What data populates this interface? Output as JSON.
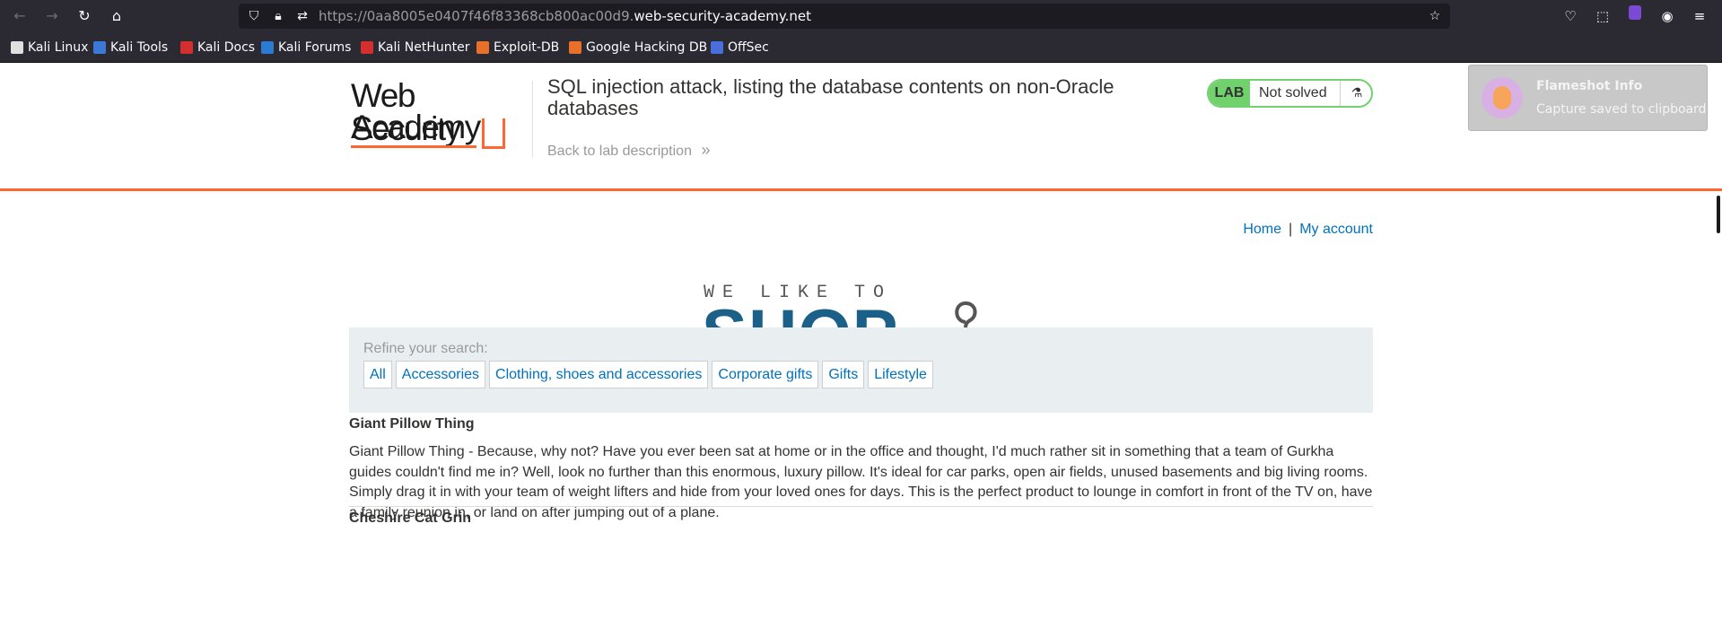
{
  "browser": {
    "url_prefix": "https://0aa8005e0407f46f83368cb800ac00d9.",
    "url_host": "web-security-academy.net",
    "icons": {
      "back": "back-arrow-icon",
      "forward": "forward-arrow-icon",
      "reload": "reload-icon",
      "home": "home-icon",
      "shield": "tracking-shield-icon",
      "lock": "lock-icon",
      "permissions": "permissions-icon",
      "bookmark_star": "star-icon",
      "pocket": "pocket-icon",
      "extensions": "extensions-icon",
      "menu": "hamburger-menu-icon"
    },
    "extension_badge": "1",
    "bookmarks": [
      {
        "label": "Kali Linux",
        "color": "#e0e0e0"
      },
      {
        "label": "Kali Tools",
        "color": "#3b78d8"
      },
      {
        "label": "Kali Docs",
        "color": "#d32f2f"
      },
      {
        "label": "Kali Forums",
        "color": "#2a7bd1"
      },
      {
        "label": "Kali NetHunter",
        "color": "#d32f2f"
      },
      {
        "label": "Exploit-DB",
        "color": "#e8702a"
      },
      {
        "label": "Google Hacking DB",
        "color": "#e8702a"
      },
      {
        "label": "OffSec",
        "color": "#4a6edb"
      }
    ]
  },
  "header": {
    "logo_line1": "Web Security",
    "logo_line2": "Academy",
    "lab_title": "SQL injection attack, listing the database contents on non-Oracle databases",
    "back_link": "Back to lab description",
    "back_chevrons": "»",
    "lab_badge": "LAB",
    "status": "Not solved",
    "flask_icon": "flask-icon"
  },
  "notification": {
    "title": "Flameshot Info",
    "message": "Capture saved to clipboard."
  },
  "nav": {
    "home": "Home",
    "separator": "|",
    "account": "My account"
  },
  "shop_logo": {
    "tagline": "WE LIKE TO",
    "word": "SHOP"
  },
  "filters": {
    "label": "Refine your search:",
    "items": [
      "All",
      "Accessories",
      "Clothing, shoes and accessories",
      "Corporate gifts",
      "Gifts",
      "Lifestyle"
    ]
  },
  "products": [
    {
      "name": "Giant Pillow Thing",
      "description": "Giant Pillow Thing - Because, why not? Have you ever been sat at home or in the office and thought, I'd much rather sit in something that a team of Gurkha guides couldn't find me in? Well, look no further than this enormous, luxury pillow. It's ideal for car parks, open air fields, unused basements and big living rooms. Simply drag it in with your team of weight lifters and hide from your loved ones for days. This is the perfect product to lounge in comfort in front of the TV on, have a family reunion in, or land on after jumping out of a plane."
    },
    {
      "name": "Cheshire Cat Grin",
      "description": ""
    }
  ],
  "colors": {
    "accent_orange": "#ff6633",
    "link_blue": "#0071bc",
    "lab_green": "#70d16d",
    "shop_blue": "#1b6089"
  }
}
